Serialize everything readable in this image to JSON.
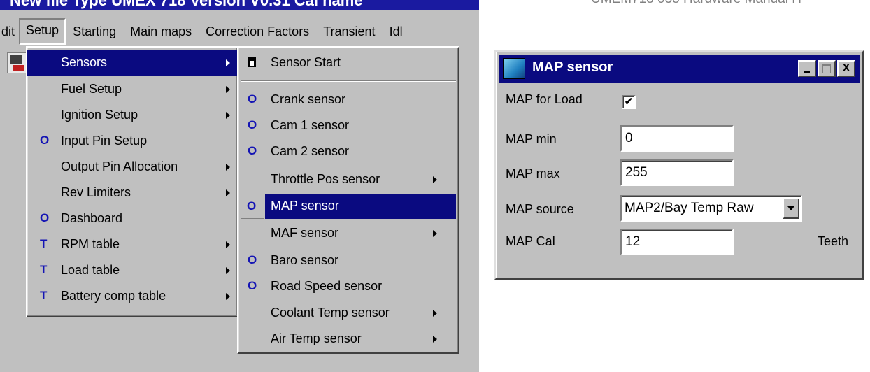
{
  "window_title": "New file   Type UMEX 718   Version  V0.31   Cal name",
  "doc_header": "UMEM718 038 Hardware Manual H",
  "menubar": [
    {
      "label": "dit"
    },
    {
      "label": "Setup"
    },
    {
      "label": "Starting"
    },
    {
      "label": "Main maps"
    },
    {
      "label": "Correction Factors"
    },
    {
      "label": "Transient"
    },
    {
      "label": "Idl"
    }
  ],
  "setup_menu": [
    {
      "label": "Sensors",
      "marker": "",
      "submenu": true,
      "highlighted": true
    },
    {
      "label": "Fuel Setup",
      "marker": "",
      "submenu": true
    },
    {
      "label": "Ignition Setup",
      "marker": "",
      "submenu": true
    },
    {
      "label": "Input Pin Setup",
      "marker": "O",
      "submenu": false
    },
    {
      "label": "Output Pin Allocation",
      "marker": "",
      "submenu": true
    },
    {
      "label": "Rev Limiters",
      "marker": "",
      "submenu": true
    },
    {
      "label": "Dashboard",
      "marker": "O",
      "submenu": false
    },
    {
      "label": "RPM table",
      "marker": "T",
      "submenu": true
    },
    {
      "label": "Load table",
      "marker": "T",
      "submenu": true
    },
    {
      "label": "Battery comp table",
      "marker": "T",
      "submenu": true
    }
  ],
  "sensors_menu": [
    {
      "label": "Sensor Start",
      "marker": "page-icon",
      "submenu": false
    },
    {
      "label": "Crank sensor",
      "marker": "O",
      "submenu": false
    },
    {
      "label": "Cam 1 sensor",
      "marker": "O",
      "submenu": false
    },
    {
      "label": "Cam 2 sensor",
      "marker": "O",
      "submenu": false
    },
    {
      "label": "Throttle Pos sensor",
      "marker": "",
      "submenu": true
    },
    {
      "label": "MAP sensor",
      "marker": "O",
      "submenu": false,
      "highlighted": true
    },
    {
      "label": "MAF sensor",
      "marker": "",
      "submenu": true
    },
    {
      "label": "Baro sensor",
      "marker": "O",
      "submenu": false
    },
    {
      "label": "Road Speed sensor",
      "marker": "O",
      "submenu": false
    },
    {
      "label": "Coolant Temp sensor",
      "marker": "",
      "submenu": true
    },
    {
      "label": "Air Temp sensor",
      "marker": "",
      "submenu": true
    }
  ],
  "dialog": {
    "title": "MAP sensor",
    "close_label": "X",
    "map_for_load": {
      "label": "MAP for Load",
      "checked": true,
      "mark": "✔"
    },
    "map_min": {
      "label": "MAP min",
      "value": "0"
    },
    "map_max": {
      "label": "MAP max",
      "value": "255"
    },
    "map_source": {
      "label": "MAP source",
      "value": "MAP2/Bay Temp Raw"
    },
    "map_cal": {
      "label": "MAP Cal",
      "value": "12",
      "unit": "Teeth"
    }
  },
  "colors": {
    "title_bar": "#0a0a80",
    "menu_bg": "#c0c0c0",
    "marker": "#1414b4",
    "highlight": "#0a0a80"
  }
}
